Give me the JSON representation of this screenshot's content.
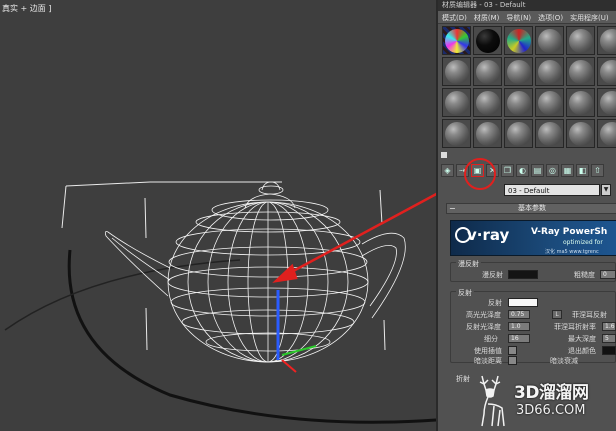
{
  "viewport": {
    "label": "真实 + 边面 ]"
  },
  "material_editor": {
    "title": "材质编辑器 - 03 - Default",
    "menu": [
      "模式(D)",
      "材质(M)",
      "导航(N)",
      "选项(O)",
      "实用程序(U)"
    ],
    "slot_count": 24,
    "material_name": "03 - Default",
    "dropdown_icon": "chevron-down-icon",
    "rollout_title": "基本参数",
    "banner": {
      "logo": "v·ray",
      "product": "V-Ray PowerSh",
      "optimized": "optimized for",
      "credit": "汉化 ma5 www.tgrenc"
    },
    "diffuse": {
      "section": "漫反射",
      "label": "漫反射",
      "roughness_label": "粗糙度",
      "roughness_value": "0"
    },
    "reflection": {
      "section": "反射",
      "reflect_label": "反射",
      "hilight_gloss_label": "高光光泽度",
      "hilight_gloss_value": "0.75",
      "lock_label": "L",
      "fresnel_label": "菲涅耳反射",
      "refl_gloss_label": "反射光泽度",
      "refl_gloss_value": "1.0",
      "fresnel_ior_label": "菲涅耳折射率",
      "fresnel_ior_value": "1.6",
      "subdivs_label": "细分",
      "subdivs_value": "16",
      "max_depth_label": "最大深度",
      "max_depth_value": "5",
      "use_interp_label": "使用插值",
      "exit_color_label": "退出颜色",
      "dim_dist_label": "暗淡距离",
      "dim_falloff_label": "暗淡衰减"
    },
    "refraction": {
      "section": "折射"
    }
  },
  "watermark": {
    "cn": "3D溜溜网",
    "url": "3D66.COM"
  },
  "colors": {
    "annotation_red": "#e0201e",
    "viewport_bg": "#3e3e3e",
    "panel_bg": "#515151"
  }
}
